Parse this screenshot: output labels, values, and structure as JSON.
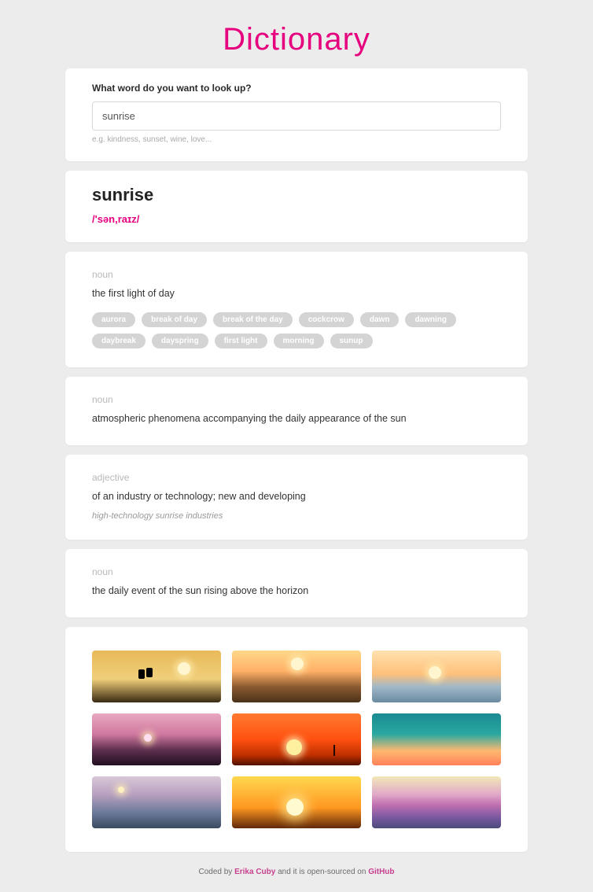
{
  "title": "Dictionary",
  "search": {
    "label": "What word do you want to look up?",
    "value": "sunrise",
    "hint": "e.g. kindness, sunset, wine, love..."
  },
  "word": {
    "headword": "sunrise",
    "pronunciation": "/'sən,raɪz/"
  },
  "meanings": [
    {
      "pos": "noun",
      "definition": "the first light of day",
      "synonyms": [
        "aurora",
        "break of day",
        "break of the day",
        "cockcrow",
        "dawn",
        "dawning",
        "daybreak",
        "dayspring",
        "first light",
        "morning",
        "sunup"
      ]
    },
    {
      "pos": "noun",
      "definition": "atmospheric phenomena accompanying the daily appearance of the sun"
    },
    {
      "pos": "adjective",
      "definition": "of an industry or technology; new and developing",
      "example": "high-technology sunrise industries"
    },
    {
      "pos": "noun",
      "definition": "the daily event of the sun rising above the horizon"
    }
  ],
  "footer": {
    "prefix": "Coded by ",
    "author": "Erika Cuby",
    "middle": " and it is open-sourced on ",
    "repo": "GitHub"
  }
}
